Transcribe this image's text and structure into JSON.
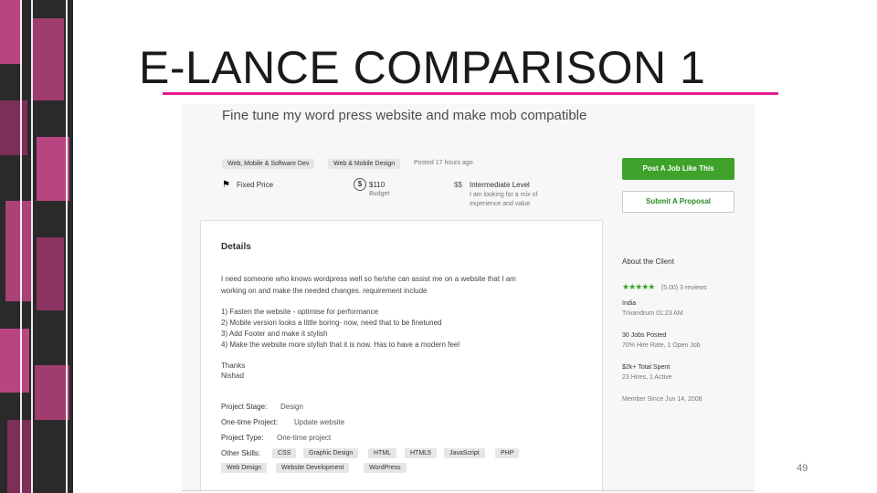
{
  "slide": {
    "title": "E-LANCE COMPARISON 1",
    "page_number": "49",
    "accent_color": "#e31a8d"
  },
  "job": {
    "title": "Fine tune my word press website and make mob compatible",
    "categories": [
      "Web, Mobile & Software Dev",
      "Web & Mobile Design"
    ],
    "posted": "Posted 17 hours ago",
    "price_type": "Fixed Price",
    "budget_value": "$110",
    "budget_label": "Budget",
    "level_symbol": "$$",
    "level_title": "Intermediate Level",
    "level_desc_1": "I am looking for a mix of",
    "level_desc_2": "experience and value"
  },
  "actions": {
    "post_job": "Post A Job Like This",
    "submit_proposal": "Submit A Proposal"
  },
  "details": {
    "heading": "Details",
    "intro_1": "I need someone who knows wordpress well so he/she can assist me on a website that I am",
    "intro_2": "working on and make the needed changes. requirement include",
    "req_1": "1) Fasten the website - optimise for performance",
    "req_2": "2) Mobile version looks a little boring- now, need that to be finetuned",
    "req_3": "3) Add Footer and make it stylish",
    "req_4": "4) Make the website more stylish that it is now. Has to have a modern feel",
    "thanks": "Thanks",
    "name": "Nishad",
    "stage_label": "Project Stage:",
    "stage_value": "Design",
    "onetime_label": "One-time Project:",
    "onetime_value": "Update website",
    "type_label": "Project Type:",
    "type_value": "One-time project",
    "skills_label": "Other Skills:",
    "skills": [
      "CSS",
      "Graphic Design",
      "HTML",
      "HTML5",
      "JavaScript",
      "PHP",
      "Web Design",
      "Website Development",
      "WordPress"
    ]
  },
  "client": {
    "heading": "About the Client",
    "rating_text": "(5.00) 3 reviews",
    "stars": 5,
    "country": "India",
    "city_time": "Trivandrum 01:23 AM",
    "jobs_posted": "30 Jobs Posted",
    "hire_rate": "70% Hire Rate, 1 Open Job",
    "total_spent": "$2k+ Total Spent",
    "hires": "23 Hires, 1 Active",
    "member_since": "Member Since Jun 14, 2008"
  },
  "icons": {
    "fixed_price": "tag-icon",
    "budget": "dollar-circle-icon",
    "star": "star-icon"
  },
  "colors": {
    "green": "#3ea22b",
    "sidebar_pink": "#d24a8f"
  }
}
